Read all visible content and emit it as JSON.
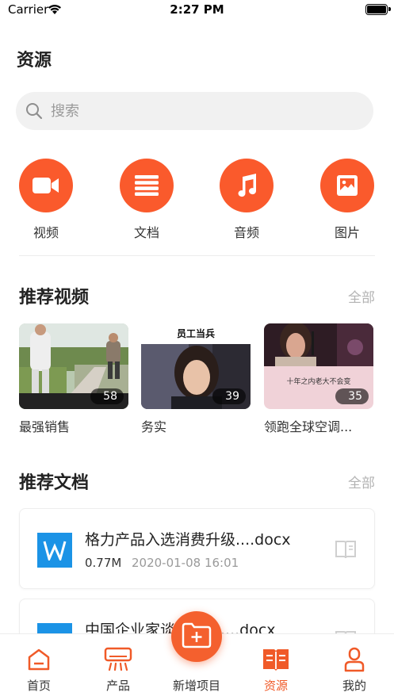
{
  "status_bar": {
    "carrier": "Carrier",
    "time": "2:27 PM"
  },
  "page": {
    "title": "资源"
  },
  "search": {
    "placeholder": "搜索"
  },
  "categories": [
    {
      "label": "视频",
      "icon": "video-camera-icon"
    },
    {
      "label": "文档",
      "icon": "list-icon"
    },
    {
      "label": "音频",
      "icon": "music-note-icon"
    },
    {
      "label": "图片",
      "icon": "image-icon"
    }
  ],
  "videos_section": {
    "title": "推荐视频",
    "more": "全部",
    "items": [
      {
        "title": "最强销售",
        "count": "58"
      },
      {
        "title": "务实",
        "count": "39",
        "caption": "员工当兵"
      },
      {
        "title": "领跑全球空调...",
        "count": "35",
        "caption": "十年之内老大不会变"
      }
    ]
  },
  "docs_section": {
    "title": "推荐文档",
    "more": "全部",
    "items": [
      {
        "name": "格力产品入选消费升级....docx",
        "size": "0.77M",
        "date": "2020-01-08 16:01"
      },
      {
        "name": "中国企业家谈什么？....docx",
        "size": "",
        "date": ""
      }
    ]
  },
  "tabbar": {
    "items": [
      {
        "label": "首页"
      },
      {
        "label": "产品"
      },
      {
        "label": "新增项目"
      },
      {
        "label": "资源"
      },
      {
        "label": "我的"
      }
    ],
    "active": "资源"
  },
  "colors": {
    "accent": "#fa5a2c",
    "doc_icon": "#1b93e6",
    "muted": "#b3b3b3"
  }
}
